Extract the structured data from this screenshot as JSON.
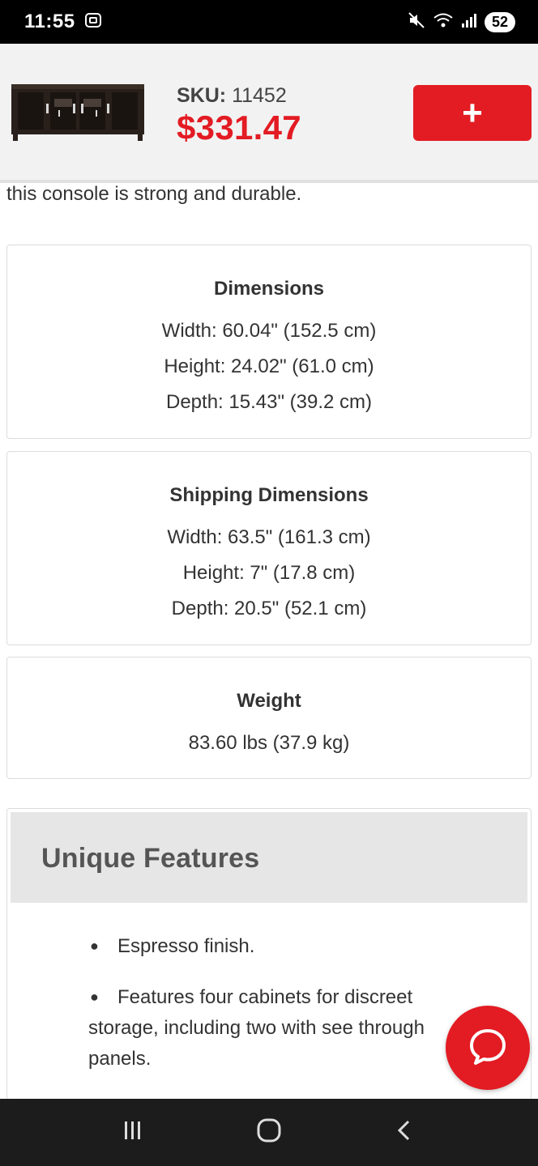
{
  "status_bar": {
    "time": "11:55",
    "battery": "52",
    "icons": [
      "screenshot-icon",
      "mute-icon",
      "wifi-icon",
      "signal-icon"
    ]
  },
  "product": {
    "sku_label": "SKU:",
    "sku_value": "11452",
    "price": "$331.47",
    "add_label": "+",
    "image": "tv-console-thumbnail"
  },
  "intro": {
    "text": "this console is strong and durable."
  },
  "dimensions": {
    "title": "Dimensions",
    "lines": [
      "Width: 60.04\" (152.5 cm)",
      "Height: 24.02\" (61.0 cm)",
      "Depth: 15.43\" (39.2 cm)"
    ]
  },
  "shipping": {
    "title": "Shipping Dimensions",
    "lines": [
      "Width: 63.5\" (161.3 cm)",
      "Height: 7\" (17.8 cm)",
      "Depth: 20.5\" (52.1 cm)"
    ]
  },
  "weight": {
    "title": "Weight",
    "lines": [
      "83.60 lbs (37.9 kg)"
    ]
  },
  "features": {
    "title": "Unique Features",
    "items": [
      "Espresso finish.",
      "Features four cabinets for discreet storage, including two with see through panels."
    ]
  },
  "chat": {
    "icon": "chat-bubble-icon"
  },
  "nav": {
    "icons": [
      "recent-apps-icon",
      "home-icon",
      "back-icon"
    ]
  },
  "colors": {
    "accent": "#e31b23",
    "header_bg": "#f2f2f2",
    "status_bg": "#000000",
    "nav_bg": "#1c1c1c"
  }
}
